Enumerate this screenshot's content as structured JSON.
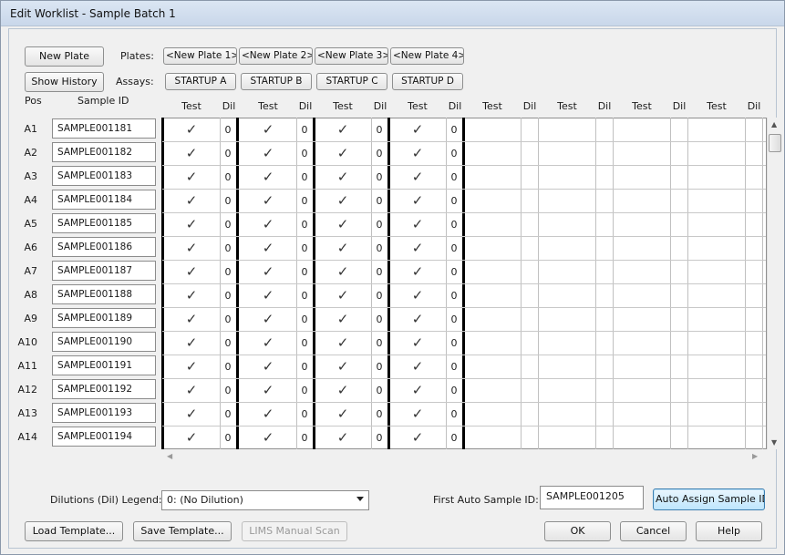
{
  "window": {
    "title": "Edit Worklist - Sample Batch 1"
  },
  "toolbar": {
    "new_plate": "New Plate",
    "show_history": "Show History",
    "plates_label": "Plates:",
    "assays_label": "Assays:",
    "plates": [
      "<New Plate 1>",
      "<New Plate 2>",
      "<New Plate 3>",
      "<New Plate 4>"
    ],
    "assays": [
      "STARTUP A",
      "STARTUP B",
      "STARTUP C",
      "STARTUP D"
    ]
  },
  "grid": {
    "pos_header": "Pos",
    "sample_header": "Sample ID",
    "test_header": "Test",
    "dil_header": "Dil",
    "rows": [
      {
        "pos": "A1",
        "sample": "SAMPLE001181"
      },
      {
        "pos": "A2",
        "sample": "SAMPLE001182"
      },
      {
        "pos": "A3",
        "sample": "SAMPLE001183"
      },
      {
        "pos": "A4",
        "sample": "SAMPLE001184"
      },
      {
        "pos": "A5",
        "sample": "SAMPLE001185"
      },
      {
        "pos": "A6",
        "sample": "SAMPLE001186"
      },
      {
        "pos": "A7",
        "sample": "SAMPLE001187"
      },
      {
        "pos": "A8",
        "sample": "SAMPLE001188"
      },
      {
        "pos": "A9",
        "sample": "SAMPLE001189"
      },
      {
        "pos": "A10",
        "sample": "SAMPLE001190"
      },
      {
        "pos": "A11",
        "sample": "SAMPLE001191"
      },
      {
        "pos": "A12",
        "sample": "SAMPLE001192"
      },
      {
        "pos": "A13",
        "sample": "SAMPLE001193"
      },
      {
        "pos": "A14",
        "sample": "SAMPLE001194"
      }
    ],
    "check_mark": "✓",
    "dil_value": "0",
    "filled_columns": 4,
    "total_columns": 8
  },
  "bottom": {
    "dilutions_label": "Dilutions (Dil) Legend:",
    "dilution_selected": "0: (No Dilution)",
    "first_auto_label": "First Auto Sample ID:",
    "first_auto_value": "SAMPLE001205",
    "auto_assign": "Auto Assign Sample IDs",
    "load_template": "Load Template...",
    "save_template": "Save Template...",
    "lims_scan": "LIMS Manual Scan",
    "ok": "OK",
    "cancel": "Cancel",
    "help": "Help"
  },
  "icons": {
    "scroll_up": "scroll-up-arrow-icon",
    "scroll_down": "scroll-down-arrow-icon",
    "scroll_left": "scroll-left-arrow-icon",
    "scroll_right": "scroll-right-arrow-icon",
    "dropdown": "chevron-down-icon"
  }
}
